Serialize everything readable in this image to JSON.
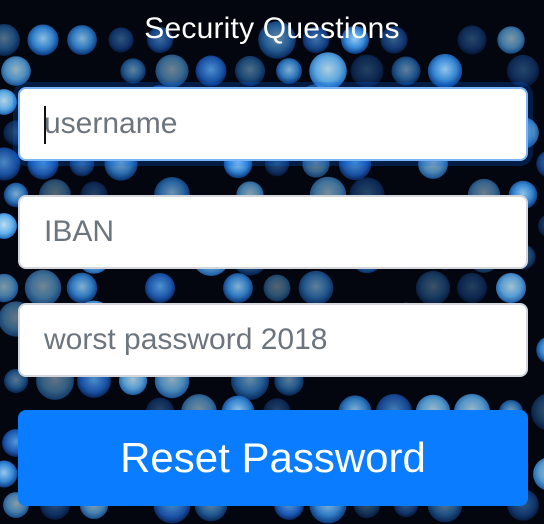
{
  "title": "Security Questions",
  "form": {
    "username_placeholder": "username",
    "iban_placeholder": "IBAN",
    "answer_placeholder": "worst password 2018",
    "submit_label": "Reset Password"
  },
  "colors": {
    "button_primary": "#0a7cff",
    "page_background": "#03060f",
    "title_text": "#ffffff"
  },
  "icons": {
    "background": "blue-bokeh-dots-pattern"
  }
}
